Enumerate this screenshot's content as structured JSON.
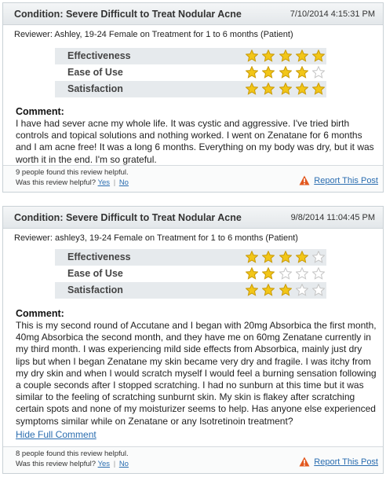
{
  "reviews": [
    {
      "condition": "Condition: Severe Difficult to Treat Nodular Acne",
      "date": "7/10/2014 4:15:31 PM",
      "reviewer": "Reviewer: Ashley, 19-24 Female on Treatment for 1 to 6 months (Patient)",
      "ratings": [
        {
          "label": "Effectiveness",
          "stars": 5
        },
        {
          "label": "Ease of Use",
          "stars": 4
        },
        {
          "label": "Satisfaction",
          "stars": 5
        }
      ],
      "comment_title": "Comment:",
      "comment": "I have had sever acne my whole life. It was cystic and aggressive. I've tried birth controls and topical solutions and nothing worked. I went on Zenatane for 6 months and I am acne free! It was a long 6 months. Everything on my body was dry, but it was worth it in the end. I'm so grateful.",
      "found_helpful": "9 people found this review helpful.",
      "helpful_q": "Was this review helpful?",
      "yes": "Yes",
      "no": "No",
      "report": "Report This Post"
    },
    {
      "condition": "Condition: Severe Difficult to Treat Nodular Acne",
      "date": "9/8/2014 11:04:45 PM",
      "reviewer": "Reviewer: ashley3, 19-24 Female on Treatment for 1 to 6 months (Patient)",
      "ratings": [
        {
          "label": "Effectiveness",
          "stars": 4
        },
        {
          "label": "Ease of Use",
          "stars": 2
        },
        {
          "label": "Satisfaction",
          "stars": 3
        }
      ],
      "comment_title": "Comment:",
      "comment": "This is my second round of Accutane and I began with 20mg Absorbica the first month, 40mg Absorbica the second month, and they have me on 60mg Zenatane currently in my third month. I was experiencing mild side effects from Absorbica, mainly just dry lips but when I began Zenatane my skin became very dry and fragile. I was itchy from my dry skin and when I would scratch myself I would feel a burning sensation following a couple seconds after I stopped scratching. I had no sunburn at this time but it was similar to the feeling of scratching sunburnt skin. My skin is flakey after scratching certain spots and none of my moisturizer seems to help. Has anyone else experienced symptoms similar while on Zenatane or any Isotretinoin treatment?",
      "hide_link": "Hide Full Comment",
      "found_helpful": "8 people found this review helpful.",
      "helpful_q": "Was this review helpful?",
      "yes": "Yes",
      "no": "No",
      "report": "Report This Post"
    }
  ],
  "colors": {
    "star_filled": "#f2c618",
    "star_empty": "#d8d8d8",
    "link": "#2a6db0",
    "warning": "#e2581f"
  },
  "icons": {
    "star": "star-icon",
    "warning": "warning-icon"
  }
}
